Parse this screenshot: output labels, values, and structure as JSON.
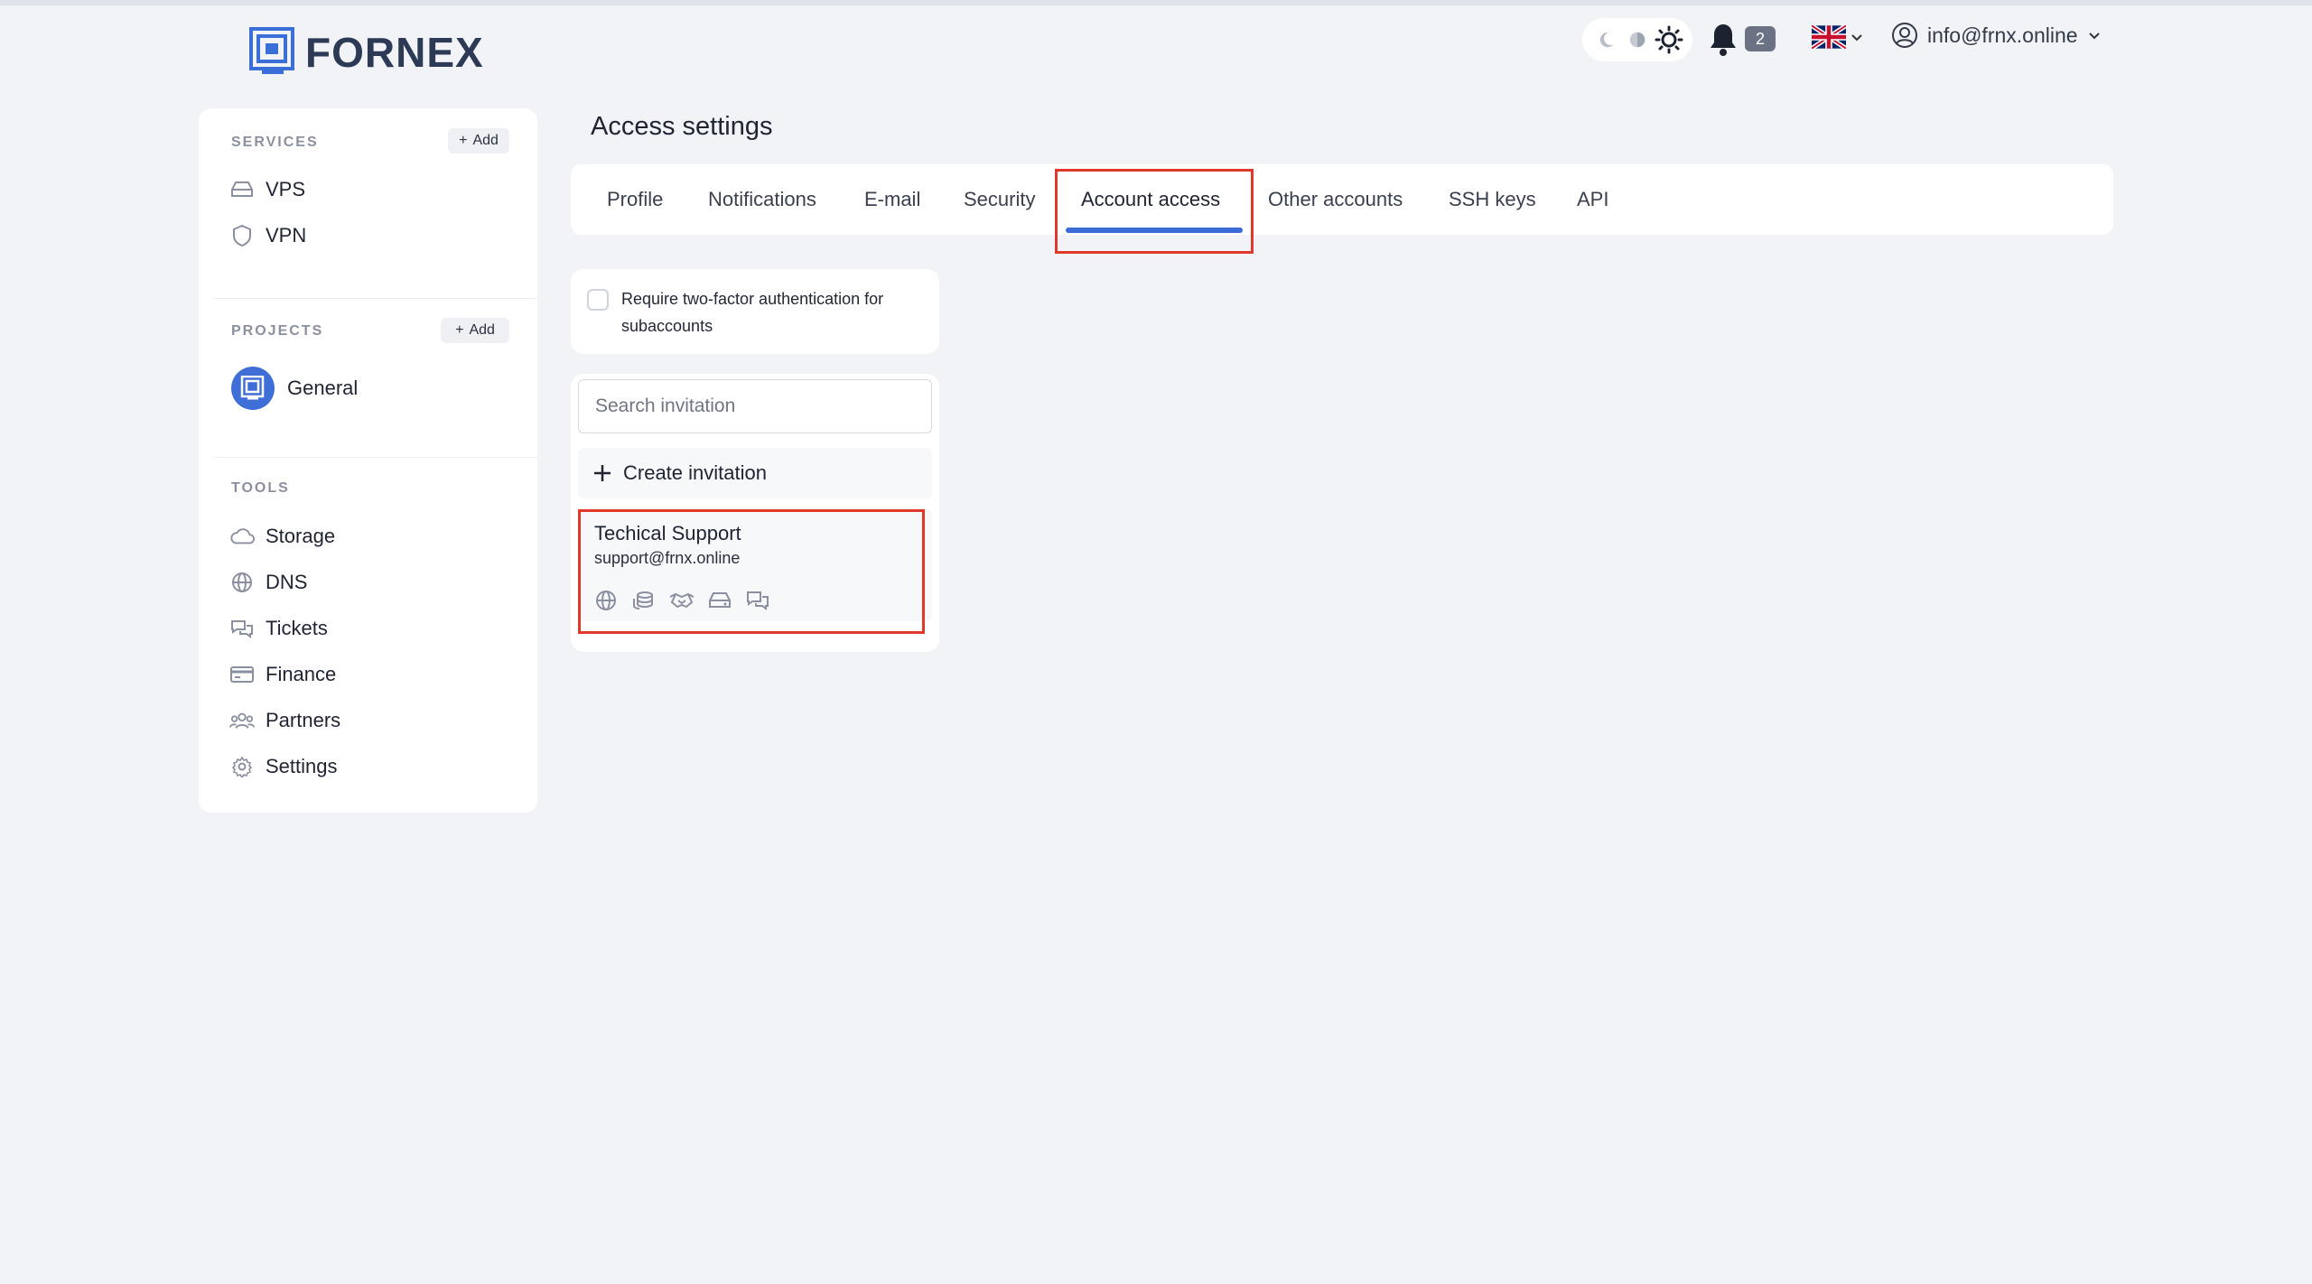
{
  "header": {
    "logo_text": "FORNEX",
    "notifications_count": "2",
    "user_email": "info@frnx.online",
    "theme_icons": [
      "moon-icon",
      "auto-theme-icon",
      "sun-icon"
    ],
    "language_flag": "uk-flag-icon"
  },
  "sidebar": {
    "services": {
      "heading": "SERVICES",
      "add_label": "Add",
      "items": [
        {
          "label": "VPS",
          "icon": "server-icon"
        },
        {
          "label": "VPN",
          "icon": "shield-icon"
        }
      ]
    },
    "projects": {
      "heading": "PROJECTS",
      "add_label": "Add",
      "items": [
        {
          "label": "General",
          "icon": "project-icon"
        }
      ]
    },
    "tools": {
      "heading": "TOOLS",
      "items": [
        {
          "label": "Storage",
          "icon": "cloud-icon"
        },
        {
          "label": "DNS",
          "icon": "globe-icon"
        },
        {
          "label": "Tickets",
          "icon": "chat-icon"
        },
        {
          "label": "Finance",
          "icon": "card-icon"
        },
        {
          "label": "Partners",
          "icon": "people-icon"
        },
        {
          "label": "Settings",
          "icon": "gear-icon"
        }
      ]
    }
  },
  "main": {
    "title": "Access settings",
    "tabs": [
      {
        "label": "Profile"
      },
      {
        "label": "Notifications"
      },
      {
        "label": "E-mail"
      },
      {
        "label": "Security"
      },
      {
        "label": "Account access",
        "active": true
      },
      {
        "label": "Other accounts"
      },
      {
        "label": "SSH keys"
      },
      {
        "label": "API"
      }
    ],
    "two_factor": {
      "label": "Require two-factor authentication for subaccounts",
      "checked": false
    },
    "invitations": {
      "search_placeholder": "Search invitation",
      "create_label": "Create invitation",
      "items": [
        {
          "name": "Techical Support",
          "email": "support@frnx.online",
          "permission_icons": [
            "globe-icon",
            "coins-icon",
            "handshake-icon",
            "server-icon",
            "chat-icon"
          ]
        }
      ]
    }
  },
  "colors": {
    "accent": "#3a6bd9",
    "highlight": "#e0392b",
    "background": "#f2f3f7"
  }
}
